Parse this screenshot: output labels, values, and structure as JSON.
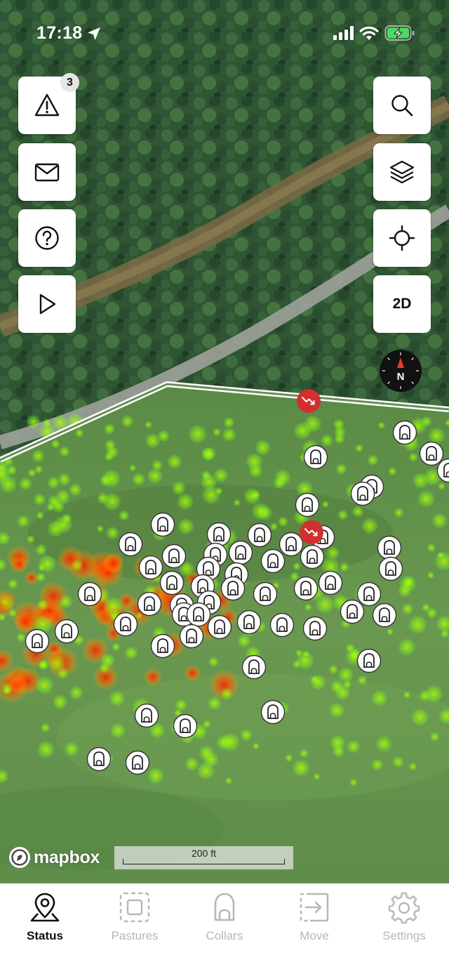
{
  "status_bar": {
    "time": "17:18",
    "location_icon": "location-arrow-icon",
    "signal_icon": "cellular-signal-icon",
    "wifi_icon": "wifi-icon",
    "battery_icon": "battery-charging-icon",
    "battery_color": "#4cd964"
  },
  "map_controls": {
    "left": [
      {
        "name": "alerts-button",
        "icon": "warning-triangle-icon",
        "badge": "3"
      },
      {
        "name": "messages-button",
        "icon": "envelope-icon"
      },
      {
        "name": "help-button",
        "icon": "question-circle-icon"
      },
      {
        "name": "play-button",
        "icon": "play-icon"
      }
    ],
    "right": [
      {
        "name": "search-button",
        "icon": "search-icon"
      },
      {
        "name": "layers-button",
        "icon": "layers-icon"
      },
      {
        "name": "locate-button",
        "icon": "crosshair-icon"
      },
      {
        "name": "view-mode-button",
        "label": "2D"
      }
    ],
    "compass": {
      "label": "N",
      "needle_color": "#e53935"
    }
  },
  "map": {
    "attribution": "mapbox",
    "scale_label": "200 ft",
    "collar_marker_icon": "collar-icon",
    "alert_marker_icon": "trend-down-alert-icon",
    "alert_color": "#d32f2f",
    "heatmap_colors": [
      "#7cff1a",
      "#ffe600",
      "#ff2a00"
    ]
  },
  "tab_bar": {
    "active_color": "#111111",
    "inactive_color": "#b7b7b7",
    "tabs": [
      {
        "label": "Status",
        "icon": "map-pin-icon",
        "active": true
      },
      {
        "label": "Pastures",
        "icon": "pasture-icon",
        "active": false
      },
      {
        "label": "Collars",
        "icon": "collar-icon",
        "active": false
      },
      {
        "label": "Move",
        "icon": "move-icon",
        "active": false
      },
      {
        "label": "Settings",
        "icon": "gear-icon",
        "active": false
      }
    ]
  }
}
